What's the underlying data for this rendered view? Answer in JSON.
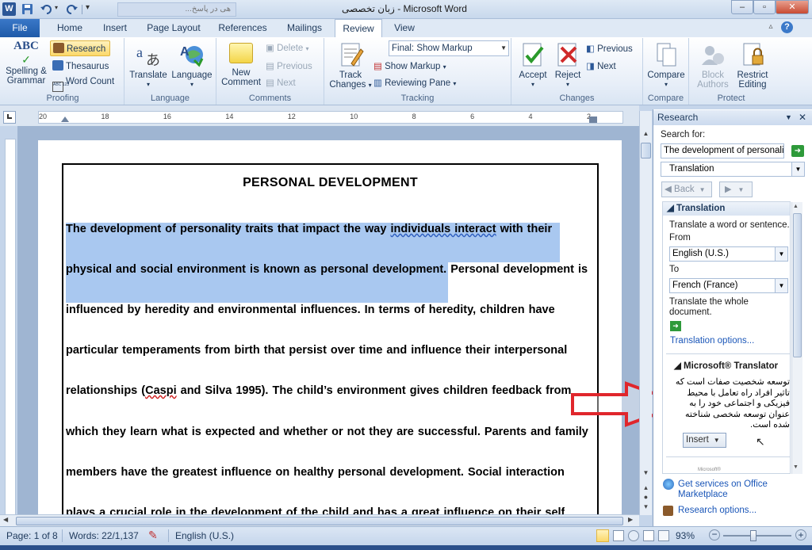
{
  "titlebar": {
    "title": "زبان تخصصی  -  Microsoft Word",
    "inactive_tab": "...هی در پاسخ",
    "minimize": "–",
    "maximize": "▫",
    "close": "✕"
  },
  "tabs": {
    "file": "File",
    "items": [
      "Home",
      "Insert",
      "Page Layout",
      "References",
      "Mailings",
      "Review",
      "View"
    ],
    "active": "Review"
  },
  "ribbon": {
    "proofing": {
      "spelling": "Spelling &",
      "grammar": "Grammar",
      "research": "Research",
      "thesaurus": "Thesaurus",
      "word_count": "Word Count",
      "label": "Proofing"
    },
    "language": {
      "translate": "Translate",
      "language": "Language",
      "label": "Language"
    },
    "comments": {
      "new1": "New",
      "new2": "Comment",
      "delete": "Delete",
      "previous": "Previous",
      "next": "Next",
      "label": "Comments"
    },
    "tracking": {
      "track1": "Track",
      "track2": "Changes",
      "final_show_markup": "Final: Show Markup",
      "show_markup": "Show Markup",
      "reviewing_pane": "Reviewing Pane",
      "label": "Tracking"
    },
    "changes": {
      "accept": "Accept",
      "reject": "Reject",
      "previous": "Previous",
      "next": "Next",
      "label": "Changes"
    },
    "compare": {
      "compare": "Compare",
      "label": "Compare"
    },
    "protect": {
      "block1": "Block",
      "block2": "Authors",
      "restrict1": "Restrict",
      "restrict2": "Editing",
      "label": "Protect"
    }
  },
  "ruler": {
    "numbers": [
      "20",
      "18",
      "16",
      "14",
      "12",
      "10",
      "8",
      "6",
      "4",
      "2"
    ]
  },
  "document": {
    "heading": "PERSONAL  DEVELOPMENT",
    "lines": [
      {
        "a": "The development of personality traits that impact the way ",
        "u": "individuals  interact",
        "b": " with their"
      },
      {
        "a": "physical and social environment is known as personal development.",
        "b": " Personal development is"
      },
      {
        "a": "influenced by heredity and environmental influences. In terms of heredity, children have"
      },
      {
        "a": "particular temperaments from birth that persist over time and influence their interpersonal"
      },
      {
        "a": "relationships (",
        "u": "Caspi",
        "b": " and Silva 1995). The child’s environment gives children feedback from"
      },
      {
        "a": "which they learn what is expected and whether or not they are successful.  Parents and family"
      },
      {
        "a": "members have the greatest influence on healthy personal development.  Social interaction"
      },
      {
        "a": "plays a crucial role in the development of the child and has a great influence on their self"
      }
    ]
  },
  "research_pane": {
    "title": "Research",
    "search_for_label": "Search for:",
    "search_value": "The development of personality",
    "service": "Translation",
    "back": "Back",
    "translation_header": "Translation",
    "translate_instruction": "Translate a word or sentence.",
    "from_label": "From",
    "from_value": "English (U.S.)",
    "to_label": "To",
    "to_value": "French (France)",
    "whole_doc1": "Translate the whole",
    "whole_doc2": "document.",
    "options_link": "Translation options...",
    "translator_header": "Microsoft® Translator",
    "arabic_text": "توسعه شخصیت صفات است که تاثیر افراد راه تعامل با محیط فیزیکی و اجتماعی خود را به عنوان توسعه شخصی شناخته شده است.",
    "insert_button": "Insert",
    "microsoft_logo": "Microsoft®",
    "get_services1": "Get services on Office",
    "get_services2": "Marketplace",
    "research_options": "Research options..."
  },
  "statusbar": {
    "page": "Page: 1 of 8",
    "words": "Words: 22/1,137",
    "language": "English (U.S.)",
    "zoom": "93%",
    "zoom_minus": "−",
    "zoom_plus": "+"
  },
  "colors": {
    "highlight": "#a9c8f0",
    "arrow": "#e0262c",
    "file_tab": "#2563b8"
  }
}
